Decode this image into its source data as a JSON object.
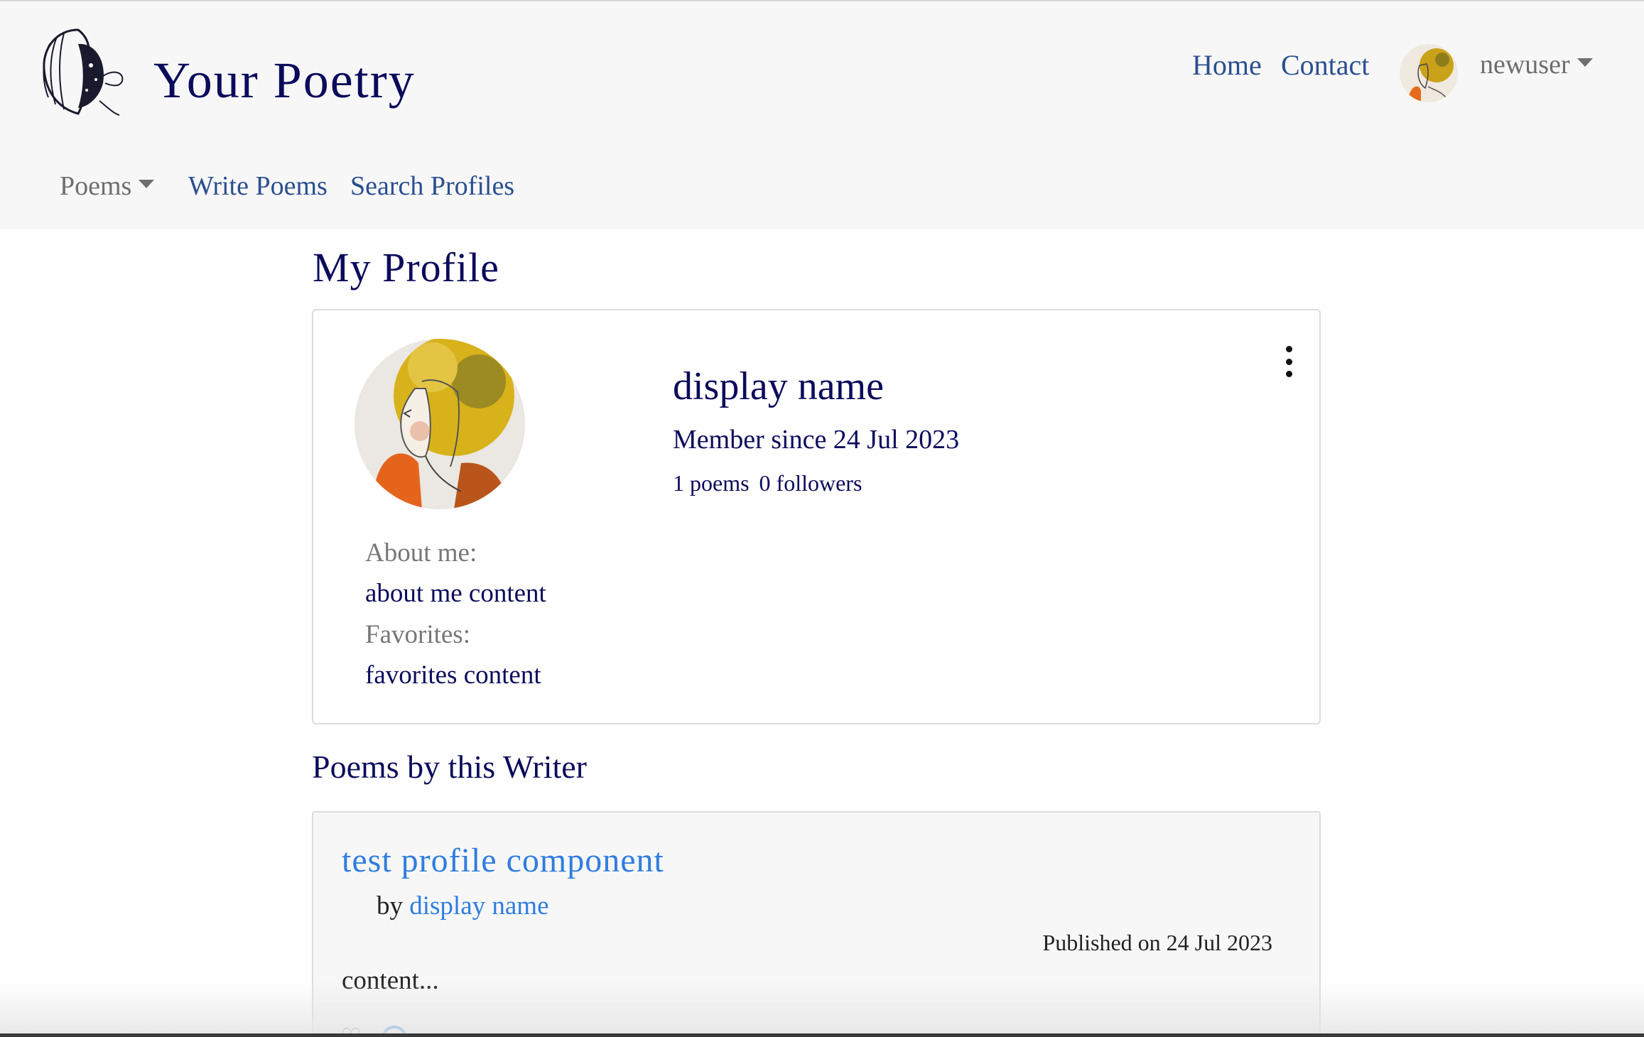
{
  "header": {
    "brand": "Your Poetry",
    "nav": {
      "home": "Home",
      "contact": "Contact"
    },
    "user": {
      "name": "newuser"
    },
    "subnav": {
      "poems": "Poems",
      "write": "Write Poems",
      "search": "Search Profiles"
    }
  },
  "page": {
    "title": "My Profile"
  },
  "profile": {
    "display_name": "display name",
    "member_since": "Member since 24 Jul 2023",
    "poems_count": "1 poems",
    "followers_count": "0 followers",
    "about_label": "About me:",
    "about_value": "about me content",
    "favorites_label": "Favorites:",
    "favorites_value": "favorites content"
  },
  "poems_section": {
    "heading": "Poems by this Writer",
    "poems": [
      {
        "title": "test profile component",
        "by_prefix": "by",
        "author": "display name",
        "published": "Published on 24 Jul 2023",
        "content": "content..."
      }
    ]
  },
  "icons": {
    "logo": "woman-face-logo",
    "menu": "kebab-menu-icon",
    "like": "heart-icon",
    "comment": "comment-icon"
  },
  "colors": {
    "brand_navy": "#0b0b5c",
    "link_blue": "#2a4f8f",
    "poem_link": "#2f7de0",
    "header_bg": "#f7f7f7"
  }
}
